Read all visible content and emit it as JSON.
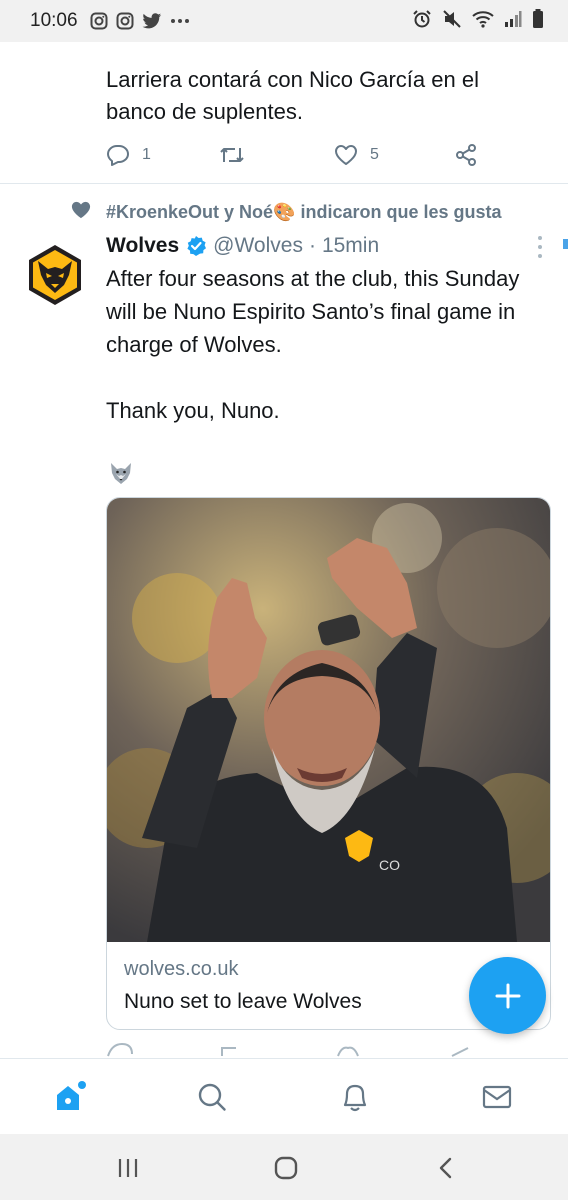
{
  "status_bar": {
    "time": "10:06",
    "left_icons": [
      "instagram-icon",
      "instagram-icon",
      "twitter-icon",
      "more-notifications-icon"
    ],
    "right_icons": [
      "alarm-icon",
      "mute-icon",
      "wifi-icon",
      "signal-icon",
      "battery-icon"
    ]
  },
  "tweet1": {
    "text": "Larriera contará con Nico García en el banco de suplentes.",
    "replies": "1",
    "likes": "5"
  },
  "tweet2": {
    "social_context": "#KroenkeOut y Noé🎨 indicaron que les gusta",
    "author_name": "Wolves",
    "handle": "@Wolves",
    "separator": "·",
    "time": "15min",
    "text_lines": [
      "After four seasons at the club, this Sunday",
      "will be Nuno Espirito Santo’s final game in",
      "charge of Wolves.",
      "Thank you, Nuno."
    ],
    "emoji": "wolf-emoji",
    "card": {
      "domain": "wolves.co.uk",
      "title": "Nuno set to leave Wolves"
    }
  },
  "bottom_nav": {
    "items": [
      "home-icon",
      "search-icon",
      "notifications-icon",
      "messages-icon"
    ],
    "active": "home-icon"
  },
  "system_nav": [
    "recents-button",
    "home-button",
    "back-button"
  ],
  "colors": {
    "accent": "#1da1f2",
    "secondary_text": "#657786",
    "wolves_gold": "#fdb913",
    "wolves_black": "#231f20"
  }
}
